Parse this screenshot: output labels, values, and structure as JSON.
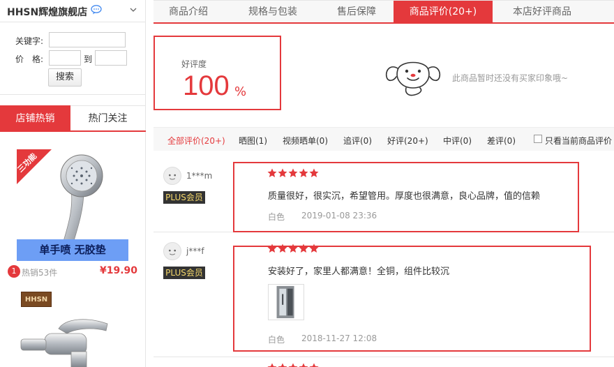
{
  "shop": {
    "name": "HHSN辉煌旗舰店"
  },
  "search": {
    "keyword_label": "关键字:",
    "price_label": "价　格:",
    "to_label": "到",
    "button_label": "搜索"
  },
  "left_tabs": {
    "hot_sales": "店铺热销",
    "hot_follow": "热门关注"
  },
  "products": [
    {
      "corner_badge": "三功能",
      "promo": "单手喷 无胶垫",
      "rank": "1",
      "sold": "热销53件",
      "price": "¥19.90"
    },
    {
      "logo": "HHSN"
    }
  ],
  "tabs": [
    {
      "label": "商品介绍"
    },
    {
      "label": "规格与包装"
    },
    {
      "label": "售后保障"
    },
    {
      "label": "商品评价(20+)"
    },
    {
      "label": "本店好评商品"
    }
  ],
  "rating": {
    "label": "好评度",
    "value": "100",
    "unit": "%",
    "no_impression": "此商品暂时还没有买家印象哦~"
  },
  "filters": [
    {
      "label": "全部评价(20+)"
    },
    {
      "label": "晒图(1)"
    },
    {
      "label": "视频晒单(0)"
    },
    {
      "label": "追评(0)"
    },
    {
      "label": "好评(20+)"
    },
    {
      "label": "中评(0)"
    },
    {
      "label": "差评(0)"
    }
  ],
  "current_only_label": "只看当前商品评价",
  "reviews": [
    {
      "user": "1***m",
      "member": "PLUS会员",
      "stars": 5,
      "text": "质量很好，很实沉，希望管用。厚度也很满意，良心品牌，值的信赖",
      "color": "白色",
      "date": "2019-01-08 23:36"
    },
    {
      "user": "j***f",
      "member": "PLUS会员",
      "stars": 5,
      "text": "安装好了，家里人都满意！全铜，组件比较沉",
      "color": "白色",
      "date": "2018-11-27 12:08"
    }
  ],
  "colors": {
    "accent": "#e4393c",
    "promo_blue": "#6d9ef5"
  }
}
